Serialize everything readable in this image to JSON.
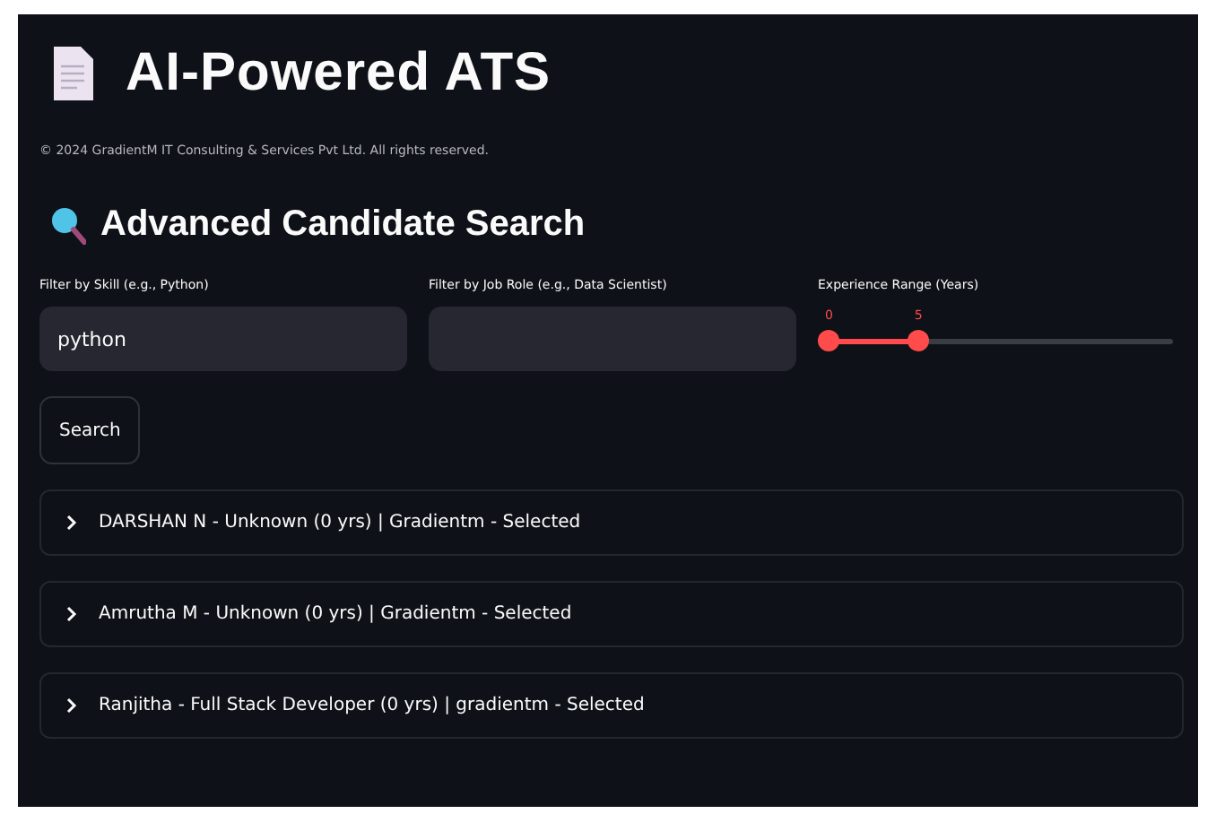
{
  "title": "AI-Powered ATS",
  "copyright": "© 2024 GradientM IT Consulting & Services Pvt Ltd. All rights reserved.",
  "section": "Advanced Candidate Search",
  "filters": [
    {
      "label": "Filter by Skill (e.g., Python)",
      "value": "python"
    },
    {
      "label": "Filter by Job Role (e.g., Data Scientist)"
    }
  ],
  "slider": {
    "label": "Experience Range (Years)",
    "thumbs": [
      {
        "label": "0",
        "level": 0
      },
      {
        "label": "5",
        "level": 0.26
      }
    ]
  },
  "search_button": "Search",
  "results": [
    {
      "text": "DARSHAN N - Unknown (0 yrs) | Gradientm - Selected",
      "expanded": false
    },
    {
      "text": "Amrutha M - Unknown (0 yrs) | Gradientm - Selected",
      "expanded": false
    },
    {
      "text": "Ranjitha - Full Stack Developer (0 yrs) | gradientm - Selected",
      "expanded": false
    }
  ]
}
